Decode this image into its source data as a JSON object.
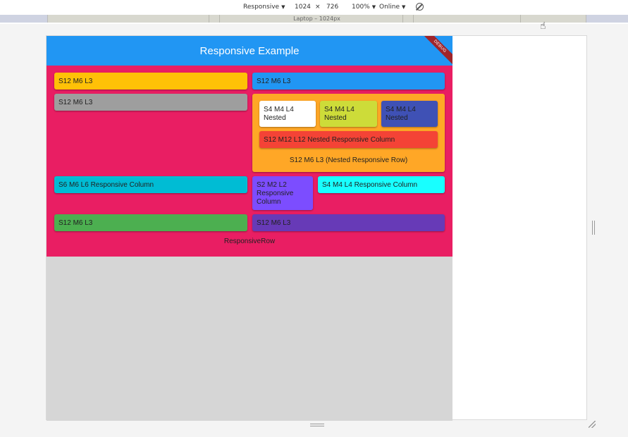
{
  "toolbar": {
    "device": "Responsive",
    "width": "1024",
    "times": "×",
    "height": "726",
    "zoom": "100%",
    "throttle": "Online",
    "rotate_icon": "rotate-icon"
  },
  "media_query": {
    "label": "Laptop – 1024px"
  },
  "app": {
    "title": "Responsive Example",
    "debug_banner": "DEBUG",
    "colors": {
      "appbar": "#2196f3",
      "body": "#e91e63"
    },
    "cards": {
      "row1_left": "S12 M6 L3",
      "row1_right": "S12 M6 L3",
      "row2_left": "S12 M6 L3",
      "nested_white": "S4 M4 L4 Nested",
      "nested_lime": "S4 M4 L4 Nested",
      "nested_indigo": "S4 M4 L4 Nested",
      "nested_column": "S12 M12 L12 Nested Responsive Column",
      "nested_caption": "S12 M6 L3 (Nested Responsive Row)",
      "column_cyan": "S6 M6 L6 Responsive Column",
      "column_purple": "S2 M2 L2 Responsive Column",
      "column_aqua": "S4 M4 L4 Responsive Column",
      "row4_left": "S12 M6 L3",
      "row4_right": "S12 M6 L3"
    },
    "row_caption": "ResponsiveRow"
  }
}
